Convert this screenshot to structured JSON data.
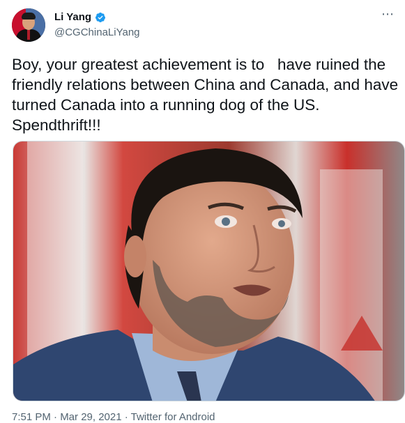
{
  "tweet": {
    "author": {
      "display_name": "Li Yang",
      "handle": "@CGChinaLiYang",
      "verified": true,
      "avatar": "avatar-photo"
    },
    "more_icon": "more-options-icon",
    "text": "Boy, your greatest achievement is to   have ruined the friendly relations between China and Canada, and have turned Canada into a running dog of the US. Spendthrift!!!",
    "media": {
      "description_icon": "photo"
    },
    "footer": "7:51 PM · Mar 29, 2021 · Twitter for Android"
  },
  "colors": {
    "text": "#0f1419",
    "secondary": "#536471",
    "verified": "#1d9bf0",
    "border": "#cfd9de"
  }
}
